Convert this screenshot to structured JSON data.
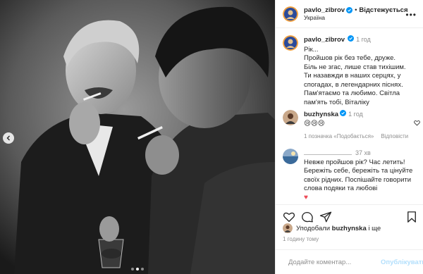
{
  "post": {
    "author": "pavlo_zibrov",
    "follow_status": "Відстежується",
    "location": "Україна",
    "separator": "•"
  },
  "caption": {
    "username": "pavlo_zibrov",
    "time": "1 год",
    "text": "Рік...\nПройшов рік без тебе, друже.\nБіль не згас, лише став тихішим.\nТи назавжди в наших серцях, у спогадах, в легендарних піснях.\nПам'ятаємо та любимо. Світла пам'ять тобі, Віталіку"
  },
  "comments": [
    {
      "username": "buzhynska",
      "time": "1 год",
      "text": "😢😢😢",
      "likes": "1 позначка «Подобається»",
      "reply": "Відповісти"
    },
    {
      "username": "",
      "time": "37 хв",
      "text": "Невже пройшов рік? Час летить! Бережіть себе, бережіть та цінуйте своїх рідних. Поспішайте говорити слова подяки та любові",
      "heart": "♥"
    }
  ],
  "liked_by": {
    "prefix": "Уподобали",
    "user": "buzhynska",
    "suffix": "і ще"
  },
  "timestamp": "1 годину тому",
  "comment_input": {
    "placeholder": "Додайте коментар...",
    "post_label": "Опублікувати"
  },
  "icons": {
    "like": "heart-icon",
    "comment": "comment-icon",
    "share": "share-icon",
    "save": "bookmark-icon"
  },
  "colors": {
    "verified": "#0095f6",
    "heart": "#ed4956",
    "post_button": "#b2dffc"
  }
}
